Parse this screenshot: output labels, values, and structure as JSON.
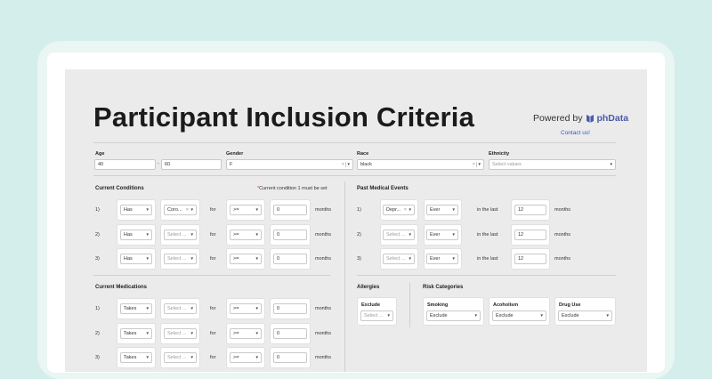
{
  "header": {
    "title": "Participant Inclusion Criteria",
    "powered_by": "Powered by",
    "brand": "phData",
    "contact": "Contact us!"
  },
  "filters": {
    "age_label": "Age",
    "age_min": "40",
    "age_dash": "-",
    "age_max": "60",
    "gender_label": "Gender",
    "gender_value": "F",
    "race_label": "Race",
    "race_value": "black",
    "ethnicity_label": "Ethnicity",
    "ethnicity_placeholder": "Select values"
  },
  "current_conditions": {
    "title": "Current Conditions",
    "note": "Current condition 1 must be set",
    "note_star": "*",
    "rows": [
      {
        "n": "1)",
        "has": "Has",
        "cond": "Coro...",
        "for": "for",
        "op": ">=",
        "val": "0",
        "unit": "months"
      },
      {
        "n": "2)",
        "has": "Has",
        "cond": "Select ...",
        "for": "for",
        "op": ">=",
        "val": "0",
        "unit": "months"
      },
      {
        "n": "3)",
        "has": "Has",
        "cond": "Select ...",
        "for": "for",
        "op": ">=",
        "val": "0",
        "unit": "months"
      }
    ]
  },
  "past_events": {
    "title": "Past Medical Events",
    "rows": [
      {
        "n": "1)",
        "event": "Depr...",
        "ever": "Ever",
        "in_last": "in the last",
        "val": "12",
        "unit": "months"
      },
      {
        "n": "2)",
        "event": "Select ...",
        "ever": "Ever",
        "in_last": "in the last",
        "val": "12",
        "unit": "months"
      },
      {
        "n": "3)",
        "event": "Select ...",
        "ever": "Ever",
        "in_last": "in the last",
        "val": "12",
        "unit": "months"
      }
    ]
  },
  "current_medications": {
    "title": "Current Medications",
    "rows": [
      {
        "n": "1)",
        "takes": "Takes",
        "med": "Select ...",
        "for": "for",
        "op": ">=",
        "val": "0",
        "unit": "months"
      },
      {
        "n": "2)",
        "takes": "Takes",
        "med": "Select ...",
        "for": "for",
        "op": ">=",
        "val": "0",
        "unit": "months"
      },
      {
        "n": "3)",
        "takes": "Takes",
        "med": "Select ...",
        "for": "for",
        "op": ">=",
        "val": "0",
        "unit": "months"
      }
    ]
  },
  "allergies": {
    "title": "Allergies",
    "label": "Exclude",
    "placeholder": "Select ..."
  },
  "risk": {
    "title": "Risk Categories",
    "items": [
      {
        "label": "Smoking",
        "value": "Exclude"
      },
      {
        "label": "Acoholism",
        "value": "Exclude"
      },
      {
        "label": "Drug Use",
        "value": "Exclude"
      }
    ]
  },
  "icons": {
    "caret": "caret-down-icon",
    "clear": "clear-x-icon",
    "logo": "phdata-logo-icon"
  },
  "colors": {
    "background": "#d4eeec",
    "page": "#ebebeb",
    "link": "#2f5fc0",
    "required": "#d64545",
    "brand": "#4a5aa8"
  }
}
